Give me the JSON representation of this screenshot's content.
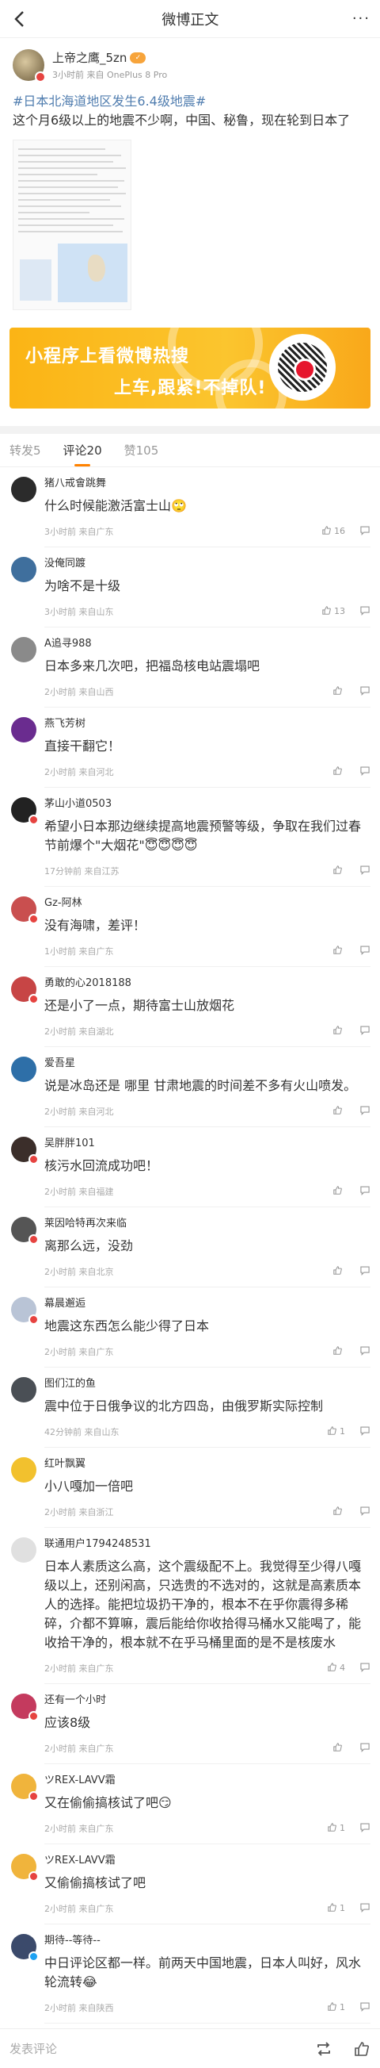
{
  "nav": {
    "title": "微博正文",
    "more": "···"
  },
  "post": {
    "author": "上帝之鹰_5zn",
    "vip_badge": "✓",
    "meta": "3小时前 来自 OnePlus 8 Pro",
    "topic": "#日本北海道地区发生6.4级地震#",
    "text": "这个月6级以上的地震不少啊，中国、秘鲁，现在轮到日本了"
  },
  "banner": {
    "line1": "小程序上看微博热搜",
    "line2": "上车,跟紧!不掉队!"
  },
  "tabs": [
    {
      "label": "转发5",
      "active": false
    },
    {
      "label": "评论20",
      "active": true
    },
    {
      "label": "赞105",
      "active": false
    }
  ],
  "comments": [
    {
      "name": "猪八戒會跳舞",
      "text": "什么时候能激活富士山🙄",
      "meta": "3小时前 来自广东",
      "likes": "16",
      "avatar_color": "#2b2b2b",
      "badge": ""
    },
    {
      "name": "没俺同踱",
      "text": "为啥不是十级",
      "meta": "3小时前 来自山东",
      "likes": "13",
      "avatar_color": "#3f6f9d",
      "badge": ""
    },
    {
      "name": "A追寻988",
      "text": "日本多来几次吧，把福岛核电站震塌吧",
      "meta": "2小时前 来自山西",
      "likes": "",
      "avatar_color": "#8a8a8a",
      "badge": ""
    },
    {
      "name": "燕飞芳树",
      "text": "直接干翻它！",
      "meta": "2小时前 来自河北",
      "likes": "",
      "avatar_color": "#6a2c8f",
      "badge": ""
    },
    {
      "name": "茅山小道0503",
      "text": "希望小日本那边继续提高地震预警等级，争取在我们过春节前爆个\"大烟花\"😇😇😇😇",
      "meta": "17分钟前 来自江苏",
      "likes": "",
      "avatar_color": "#222222",
      "badge": "red"
    },
    {
      "name": "Gz-阿林",
      "text": "没有海啸，差评！",
      "meta": "1小时前 来自广东",
      "likes": "",
      "avatar_color": "#c94f4f",
      "badge": "red"
    },
    {
      "name": "勇敢的心2018188",
      "text": "还是小了一点，期待富士山放烟花",
      "meta": "2小时前 来自湖北",
      "likes": "",
      "avatar_color": "#c74545",
      "badge": "red"
    },
    {
      "name": "爱吾星",
      "text": "说是冰岛还是 哪里 甘肃地震的时间差不多有火山喷发。",
      "meta": "2小时前 来自河北",
      "likes": "",
      "avatar_color": "#2e6fa8",
      "badge": ""
    },
    {
      "name": "吴胖胖101",
      "text": "核污水回流成功吧！",
      "meta": "2小时前 来自福建",
      "likes": "",
      "avatar_color": "#3b2e2a",
      "badge": "red"
    },
    {
      "name": "莱因哈特再次来临",
      "text": "离那么远，没劲",
      "meta": "2小时前 来自北京",
      "likes": "",
      "avatar_color": "#555555",
      "badge": "red"
    },
    {
      "name": "幕晨邂逅",
      "text": "地震这东西怎么能少得了日本",
      "meta": "2小时前 来自广东",
      "likes": "",
      "avatar_color": "#b9c4d6",
      "badge": "red"
    },
    {
      "name": "图们江的鱼",
      "text": "震中位于日俄争议的北方四岛，由俄罗斯实际控制",
      "meta": "42分钟前 来自山东",
      "likes": "1",
      "avatar_color": "#4a4f55",
      "badge": ""
    },
    {
      "name": "红叶飘翼",
      "text": "小八嘎加一倍吧",
      "meta": "2小时前 来自浙江",
      "likes": "",
      "avatar_color": "#f2c12e",
      "badge": ""
    },
    {
      "name": "联通用户1794248531",
      "text": "日本人素质这么高，这个震级配不上。我觉得至少得八嘎级以上，还别闲高，只选贵的不选对的，这就是高素质本人的选择。能把垃圾扔干净的，根本不在乎你震得多稀碎，介都不算嘛，震后能给你收拾得马桶水又能喝了，能收拾干净的，根本就不在乎马桶里面的是不是核废水",
      "meta": "2小时前 来自广东",
      "likes": "4",
      "avatar_color": "#e0e0e0",
      "badge": ""
    },
    {
      "name": "还有一个小时",
      "text": "应该8级",
      "meta": "2小时前 来自广东",
      "likes": "",
      "avatar_color": "#c43a5e",
      "badge": "red"
    },
    {
      "name": "ツREX-LAVV霜",
      "text": "又在偷偷搞核试了吧😏",
      "meta": "2小时前 来自广东",
      "likes": "1",
      "avatar_color": "#f0b43c",
      "badge": "red"
    },
    {
      "name": "ツREX-LAVV霜",
      "text": "又偷偷搞核试了吧",
      "meta": "2小时前 来自广东",
      "likes": "1",
      "avatar_color": "#f0b43c",
      "badge": "red"
    },
    {
      "name": "期待--等待--",
      "text": "中日评论区都一样。前两天中国地震，日本人叫好，风水轮流转😂",
      "meta": "2小时前 来自陕西",
      "likes": "1",
      "avatar_color": "#3b4a6b",
      "badge": "blue"
    }
  ],
  "bottom": {
    "placeholder": "发表评论"
  }
}
